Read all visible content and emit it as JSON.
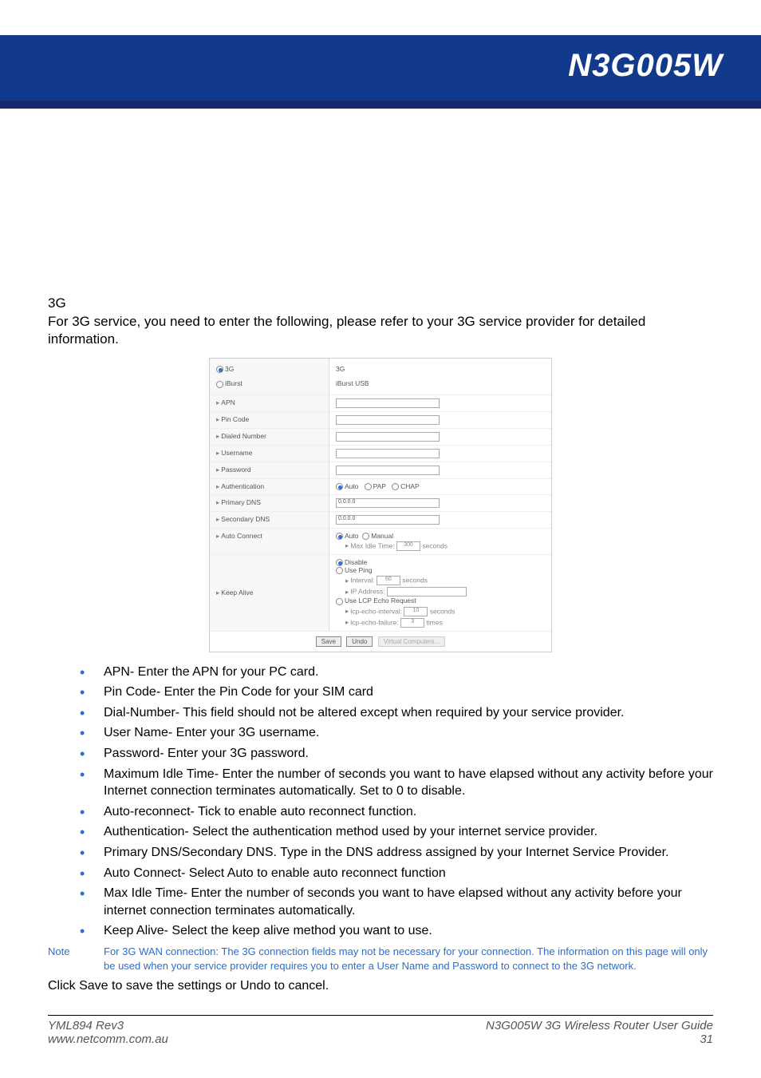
{
  "header": {
    "product": "N3G005W"
  },
  "section": {
    "heading": "3G",
    "intro": "For 3G service, you need to enter the following, please refer to your 3G service provider for detailed information."
  },
  "screenshot": {
    "wan_type": {
      "opt_3g": "3G",
      "opt_iburst": "iBurst",
      "val_3g": "3G",
      "val_iburst": "iBurst USB"
    },
    "rows": {
      "apn": "APN",
      "pin": "Pin Code",
      "dialed": "Dialed Number",
      "user": "Username",
      "pass": "Password",
      "auth": "Authentication",
      "pdns": "Primary DNS",
      "sdns": "Secondary DNS",
      "autoconn": "Auto Connect",
      "keepalive": "Keep Alive"
    },
    "auth": {
      "auto": "Auto",
      "pap": "PAP",
      "chap": "CHAP"
    },
    "dns_value": "0.0.0.0",
    "autoconn": {
      "auto": "Auto",
      "manual": "Manual",
      "max_idle_label": "Max Idle Time:",
      "max_idle_value": "300",
      "seconds": "seconds"
    },
    "keepalive": {
      "disable": "Disable",
      "use_ping": "Use Ping",
      "interval_label": "Interval:",
      "interval_value": "60",
      "seconds": "seconds",
      "ip_label": "IP Address:",
      "use_lcp": "Use LCP Echo Request",
      "lcp_int_label": "lcp-echo-interval:",
      "lcp_int_value": "10",
      "lcp_fail_label": "lcp-echo-failure:",
      "lcp_fail_value": "3",
      "times": "times"
    },
    "buttons": {
      "save": "Save",
      "undo": "Undo",
      "vc": "Virtual Computers..."
    }
  },
  "bullets": [
    "APN- Enter the APN for your PC card.",
    "Pin Code- Enter the Pin Code for your SIM card",
    "Dial-Number- This field should not be altered except when required by your service provider.",
    "User Name- Enter your 3G username.",
    "Password- Enter your 3G password.",
    "Maximum Idle Time- Enter the number of seconds you want to have elapsed without any activity before your Internet connection terminates automatically. Set to 0 to disable.",
    "Auto-reconnect- Tick to enable auto reconnect function.",
    "Authentication- Select the authentication method used by your internet service provider.",
    "Primary DNS/Secondary DNS. Type in the DNS address assigned by your Internet Service Provider.",
    "Auto Connect- Select Auto to enable auto reconnect function",
    "Max Idle Time- Enter the number of seconds you want to have elapsed without any activity before your internet connection terminates automatically.",
    "Keep Alive- Select the keep alive method you want to use."
  ],
  "note": {
    "label": "Note",
    "text": "For 3G WAN connection: The 3G connection fields may not be necessary for your connection. The information on this page will only be used when your service provider requires you to enter a User Name and Password to connect to the 3G network."
  },
  "closing": "Click Save to save the settings or Undo to cancel.",
  "footer": {
    "rev": "YML894 Rev3",
    "url": "www.netcomm.com.au",
    "guide": "N3G005W 3G Wireless Router User Guide",
    "page": "31"
  }
}
